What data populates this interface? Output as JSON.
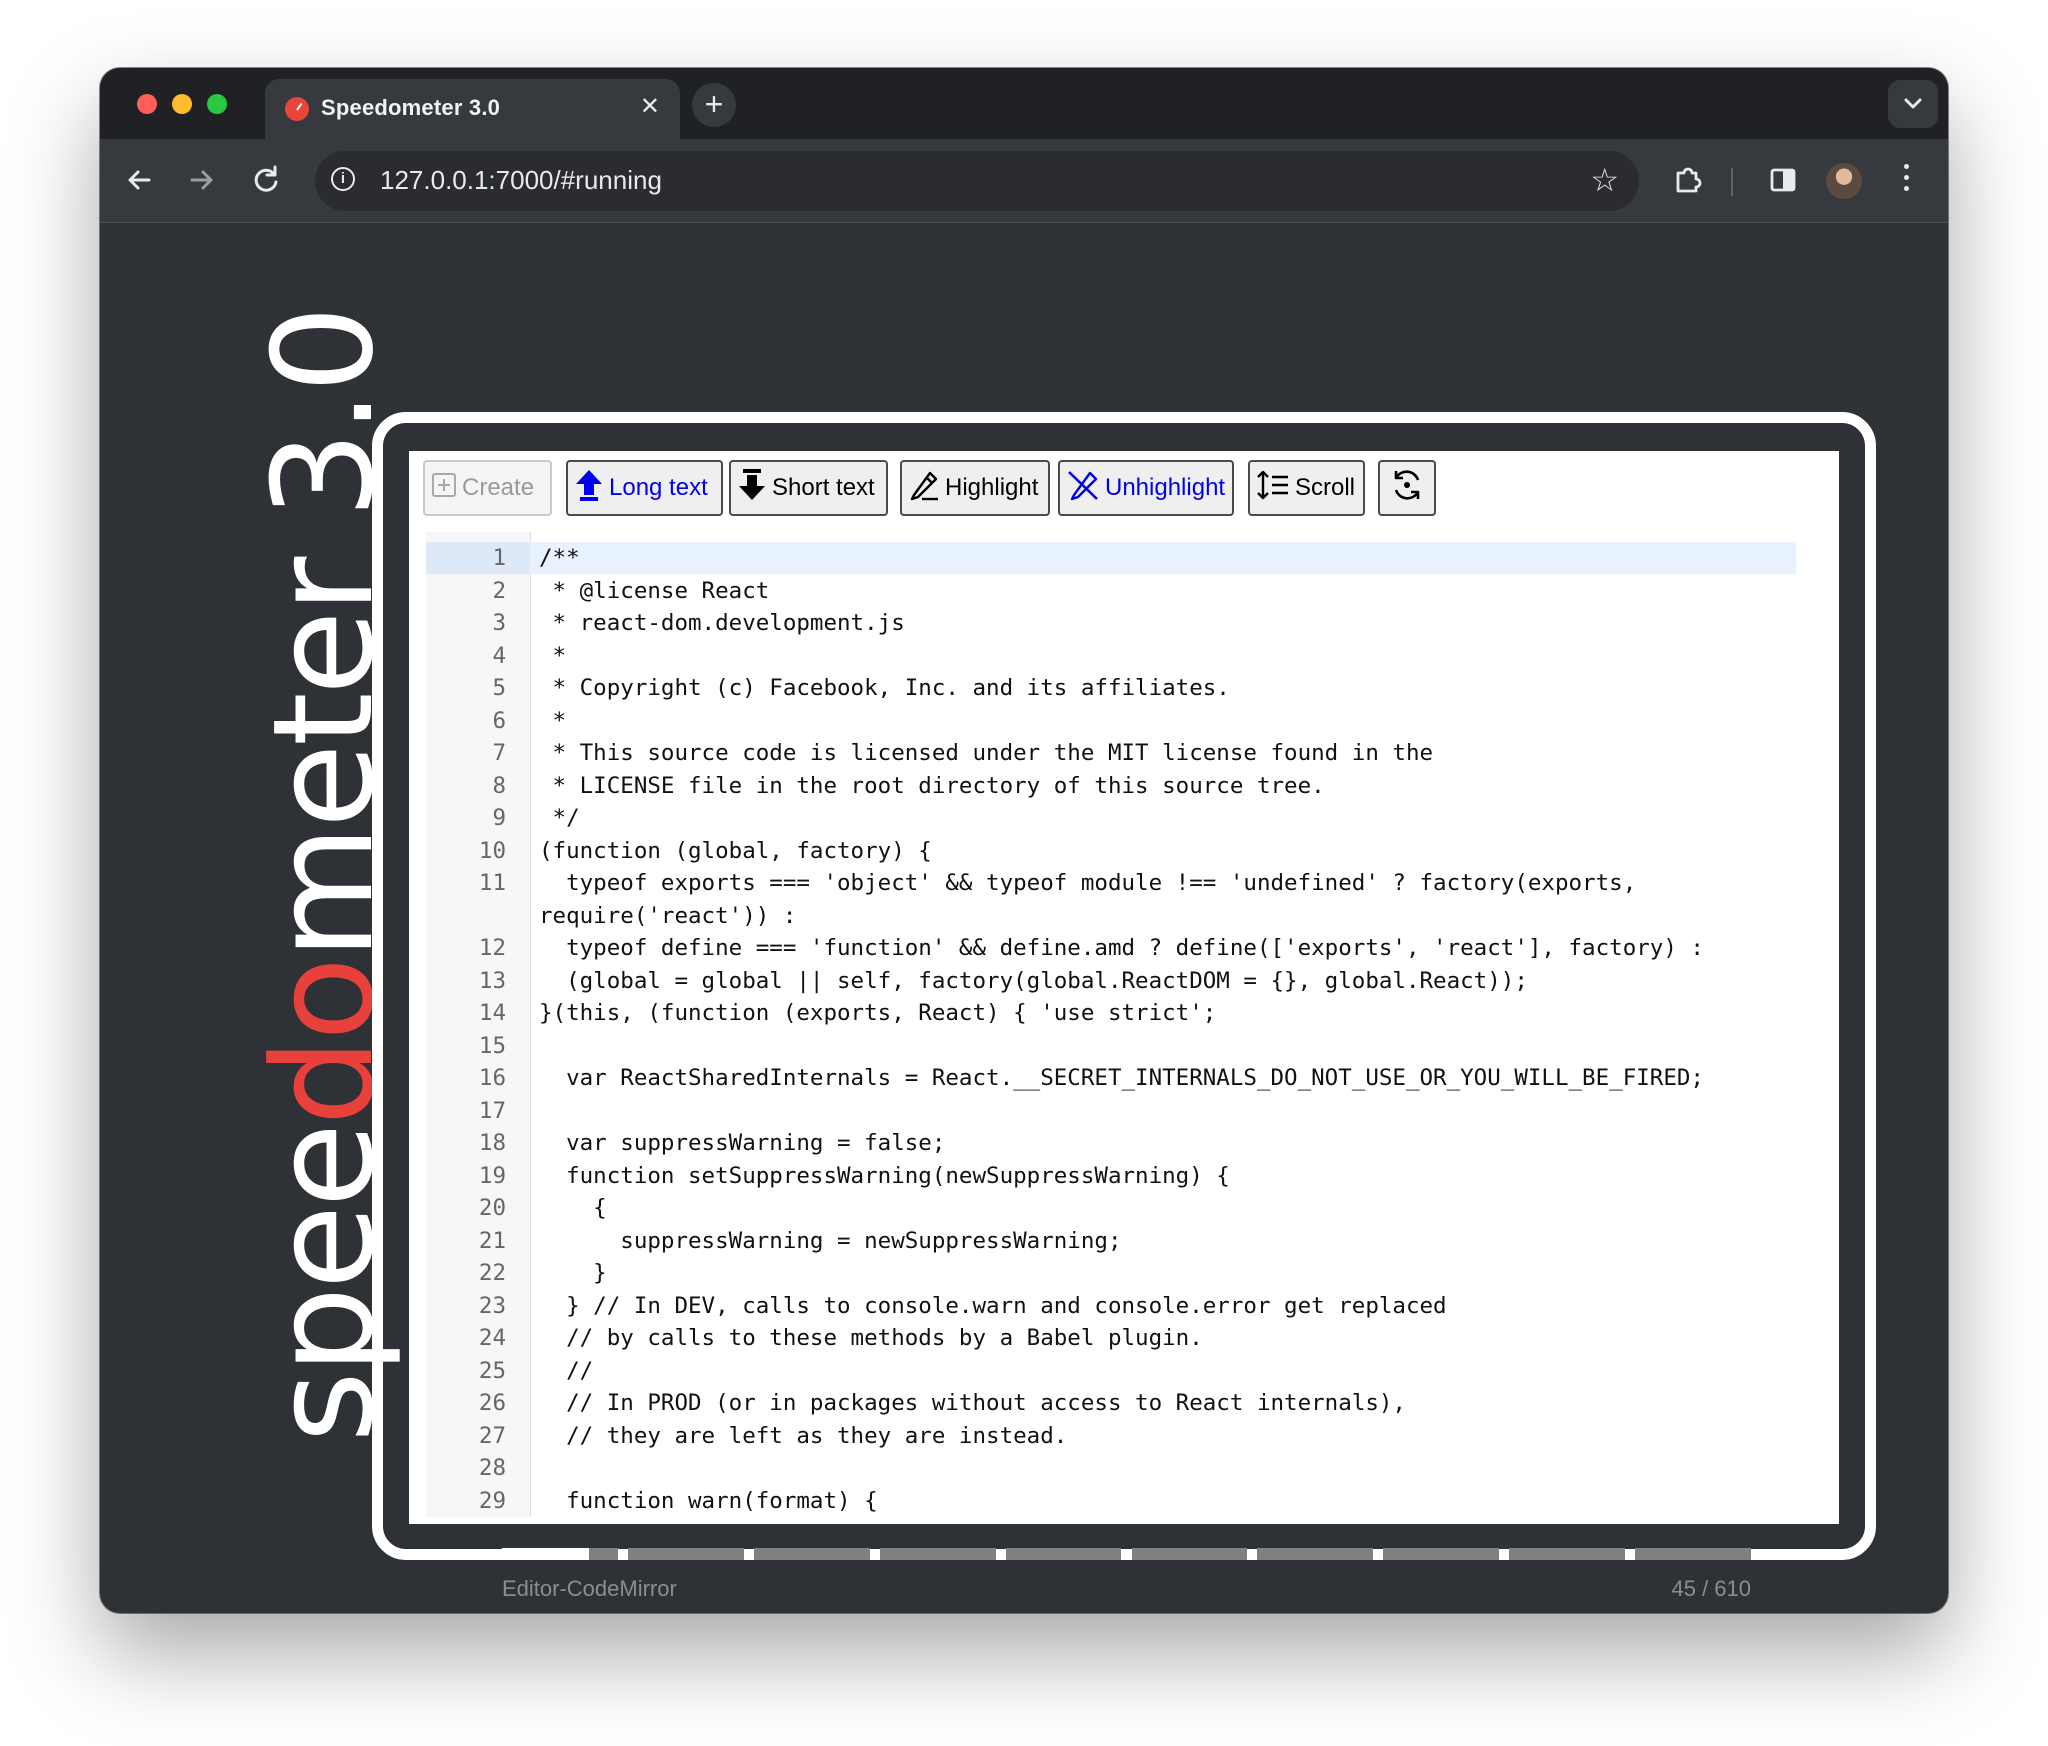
{
  "browser": {
    "tab_title": "Speedometer 3.0",
    "tab_close": "✕",
    "new_tab": "+",
    "url": "127.0.0.1:7000/#running",
    "info_glyph": "i"
  },
  "logo": {
    "prefix": "spee",
    "accent": "do",
    "suffix": "meter 3.0",
    "accent_color": "#e8403a"
  },
  "toolbar_buttons": {
    "create": "Create",
    "long_text": "Long text",
    "short_text": "Short text",
    "highlight": "Highlight",
    "unhighlight": "Unhighlight",
    "scroll": "Scroll"
  },
  "editor": {
    "lines": [
      {
        "n": "1",
        "t": "/**"
      },
      {
        "n": "2",
        "t": " * @license React"
      },
      {
        "n": "3",
        "t": " * react-dom.development.js"
      },
      {
        "n": "4",
        "t": " *"
      },
      {
        "n": "5",
        "t": " * Copyright (c) Facebook, Inc. and its affiliates."
      },
      {
        "n": "6",
        "t": " *"
      },
      {
        "n": "7",
        "t": " * This source code is licensed under the MIT license found in the"
      },
      {
        "n": "8",
        "t": " * LICENSE file in the root directory of this source tree."
      },
      {
        "n": "9",
        "t": " */"
      },
      {
        "n": "10",
        "t": "(function (global, factory) {"
      },
      {
        "n": "11",
        "t": "  typeof exports === 'object' && typeof module !== 'undefined' ? factory(exports,"
      },
      {
        "n": "",
        "t": "require('react')) :"
      },
      {
        "n": "12",
        "t": "  typeof define === 'function' && define.amd ? define(['exports', 'react'], factory) :"
      },
      {
        "n": "13",
        "t": "  (global = global || self, factory(global.ReactDOM = {}, global.React));"
      },
      {
        "n": "14",
        "t": "}(this, (function (exports, React) { 'use strict';"
      },
      {
        "n": "15",
        "t": ""
      },
      {
        "n": "16",
        "t": "  var ReactSharedInternals = React.__SECRET_INTERNALS_DO_NOT_USE_OR_YOU_WILL_BE_FIRED;"
      },
      {
        "n": "17",
        "t": ""
      },
      {
        "n": "18",
        "t": "  var suppressWarning = false;"
      },
      {
        "n": "19",
        "t": "  function setSuppressWarning(newSuppressWarning) {"
      },
      {
        "n": "20",
        "t": "    {"
      },
      {
        "n": "21",
        "t": "      suppressWarning = newSuppressWarning;"
      },
      {
        "n": "22",
        "t": "    }"
      },
      {
        "n": "23",
        "t": "  } // In DEV, calls to console.warn and console.error get replaced"
      },
      {
        "n": "24",
        "t": "  // by calls to these methods by a Babel plugin."
      },
      {
        "n": "25",
        "t": "  //"
      },
      {
        "n": "26",
        "t": "  // In PROD (or in packages without access to React internals),"
      },
      {
        "n": "27",
        "t": "  // they are left as they are instead."
      },
      {
        "n": "28",
        "t": ""
      },
      {
        "n": "29",
        "t": "  function warn(format) {"
      }
    ]
  },
  "progress": {
    "suite_name": "Editor-CodeMirror",
    "counter": "45 / 610",
    "fraction_complete": 0.07
  }
}
